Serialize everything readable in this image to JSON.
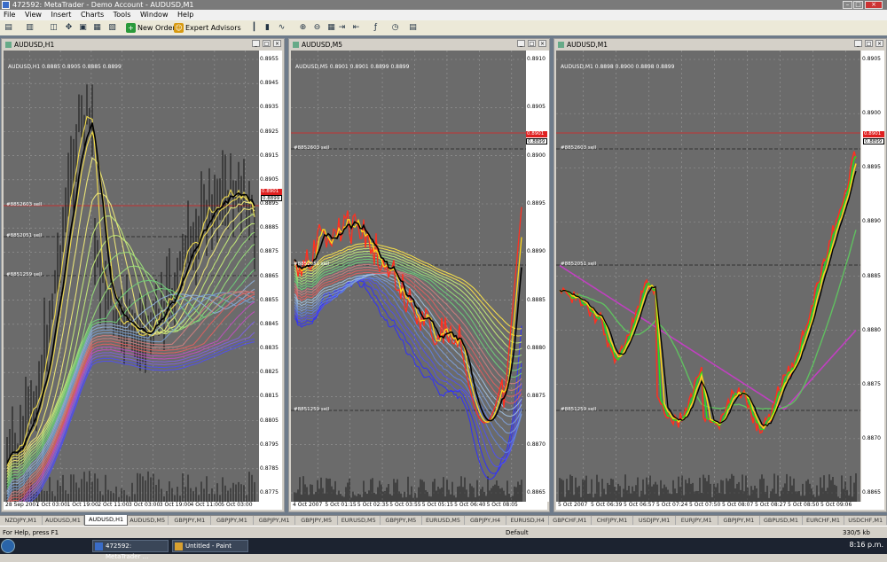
{
  "window": {
    "title": "472592: MetaTrader - Demo Account - AUDUSD,M1"
  },
  "menu": [
    "File",
    "View",
    "Insert",
    "Charts",
    "Tools",
    "Window",
    "Help"
  ],
  "toolbar": {
    "new_order": "New Order",
    "expert_advisors": "Expert Advisors"
  },
  "charts": [
    {
      "title": "AUDUSD,H1",
      "ohlc": "AUDUSD,H1  0.8885 0.8905 0.8885 0.8899",
      "price_labels": [
        "0.8955",
        "0.8945",
        "0.8935",
        "0.8925",
        "0.8915",
        "0.8905",
        "0.8895",
        "0.8885",
        "0.8875",
        "0.8865",
        "0.8855",
        "0.8845",
        "0.8835",
        "0.8825",
        "0.8815",
        "0.8805",
        "0.8795",
        "0.8785",
        "0.8775"
      ],
      "time_labels": [
        "28 Sep 2007",
        "1 Oct 03:00",
        "1 Oct 19:00",
        "2 Oct 11:00",
        "3 Oct 03:00",
        "3 Oct 19:00",
        "4 Oct 11:00",
        "5 Oct 03:00"
      ],
      "orders": [
        "#8852603 sell",
        "#8852051 sell",
        "#8851259 sell"
      ],
      "bid_tag": "0.8899",
      "ask_tag": "0.8901"
    },
    {
      "title": "AUDUSD,M5",
      "ohlc": "AUDUSD,M5  0.8901 0.8901 0.8899 0.8899",
      "price_labels": [
        "0.8910",
        "0.8905",
        "0.8900",
        "0.8895",
        "0.8890",
        "0.8885",
        "0.8880",
        "0.8875",
        "0.8870",
        "0.8865"
      ],
      "time_labels": [
        "4 Oct 2007",
        "5 Oct 01:15",
        "5 Oct 02:35",
        "5 Oct 03:55",
        "5 Oct 05:15",
        "5 Oct 06:40",
        "5 Oct 08:05"
      ],
      "orders": [
        "#8852603 sell",
        "#8852051 sell",
        "#8851259 sell"
      ],
      "bid_tag": "0.8899",
      "ask_tag": "0.8901"
    },
    {
      "title": "AUDUSD,M1",
      "ohlc": "AUDUSD,M1  0.8898 0.8900 0.8898 0.8899",
      "price_labels": [
        "0.8905",
        "0.8900",
        "0.8895",
        "0.8890",
        "0.8885",
        "0.8880",
        "0.8875",
        "0.8870",
        "0.8865"
      ],
      "time_labels": [
        "5 Oct 2007",
        "5 Oct 06:39",
        "5 Oct 06:57",
        "5 Oct 07:24",
        "5 Oct 07:50",
        "5 Oct 08:07",
        "5 Oct 08:27",
        "5 Oct 08:50",
        "5 Oct 09:06"
      ],
      "orders": [
        "#8852603 sell",
        "#8852051 sell",
        "#8851259 sell"
      ],
      "bid_tag": "0.8899",
      "ask_tag": "0.8901"
    }
  ],
  "tabs": [
    "NZDJPY,M1",
    "AUDUSD,M1",
    "AUDUSD,H1",
    "AUDUSD,M5",
    "GBPJPY,M1",
    "GBPJPY,M1",
    "GBPJPY,M1",
    "GBPJPY,M5",
    "EURUSD,M5",
    "GBPJPY,M5",
    "EURUSD,M5",
    "GBPJPY,H4",
    "EURUSD,H4",
    "GBPCHF,M1",
    "CHFJPY,M1",
    "USDJPY,M1",
    "EURJPY,M1",
    "GBPJPY,M1",
    "GBPUSD,M1",
    "EURCHF,M1",
    "USDCHF,M1"
  ],
  "active_tab_index": 2,
  "status": {
    "help": "For Help, press F1",
    "profile": "Default",
    "traffic": "330/5 kb"
  },
  "taskbar": {
    "task1": "472592: MetaTrader ...",
    "task2": "Untitled - Paint",
    "clock": "8:16 p.m."
  },
  "colors": {
    "chart_bg": "#6b6b6b",
    "grid": "#9a9a9a",
    "accent_red": "#e02020",
    "accent_yellow": "#ffd81a"
  }
}
